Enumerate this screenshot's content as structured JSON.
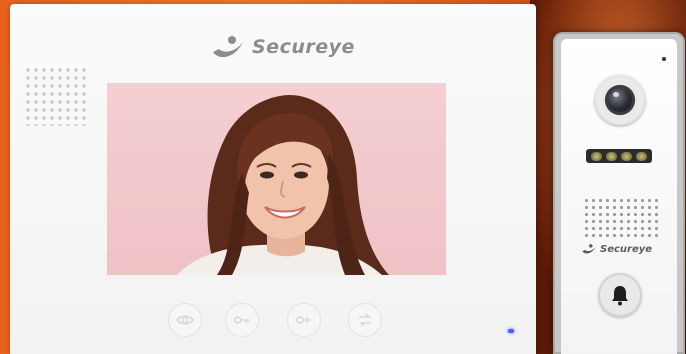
{
  "monitor": {
    "brand": "Secureye",
    "controls": [
      {
        "name": "eye-icon"
      },
      {
        "name": "key-icon"
      },
      {
        "name": "unlock-icon"
      },
      {
        "name": "transfer-icon"
      }
    ]
  },
  "doorbell": {
    "brand": "Secureye",
    "bell_icon": "bell-icon"
  },
  "colors": {
    "background": "#ee7a2a",
    "panel": "#f7f7f7",
    "brand_text": "#8d8d8d",
    "screen_bg": "#f2c8cb",
    "status_led": "#4a5cff"
  }
}
